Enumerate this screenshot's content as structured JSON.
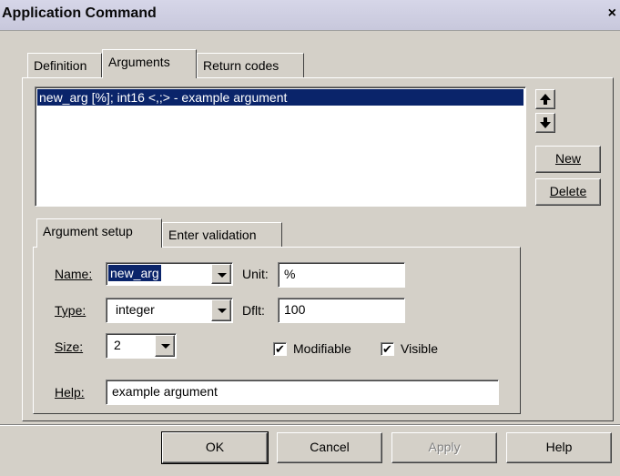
{
  "window": {
    "title": "Application Command",
    "close_glyph": "×"
  },
  "tabs": [
    {
      "label": "Definition"
    },
    {
      "label": "Arguments"
    },
    {
      "label": "Return codes"
    }
  ],
  "arguments_list": {
    "items": [
      "new_arg [%]; int16 <,;> - example argument"
    ],
    "selected": 0
  },
  "side_buttons": {
    "move_up_icon": "arrow-up-icon",
    "move_down_icon": "arrow-down-icon",
    "new": "New",
    "delete": "Delete"
  },
  "subtabs": [
    {
      "label": "Argument setup"
    },
    {
      "label": "Enter validation"
    }
  ],
  "form": {
    "name_label": "Name:",
    "name_value": "new_arg",
    "unit_label": "Unit:",
    "unit_value": "%",
    "type_label": "Type:",
    "type_value": "integer",
    "dflt_label": "Dflt:",
    "dflt_value": "100",
    "size_label": "Size:",
    "size_value": "2",
    "modifiable_label": "Modifiable",
    "modifiable_checked": true,
    "visible_label": "Visible",
    "visible_checked": true,
    "help_label": "Help:",
    "help_value": "example argument"
  },
  "footer": {
    "ok": "OK",
    "cancel": "Cancel",
    "apply": "Apply",
    "help": "Help"
  },
  "colors": {
    "selection": "#0a246a",
    "face": "#d4d0c8",
    "disabled_text": "#808080"
  }
}
